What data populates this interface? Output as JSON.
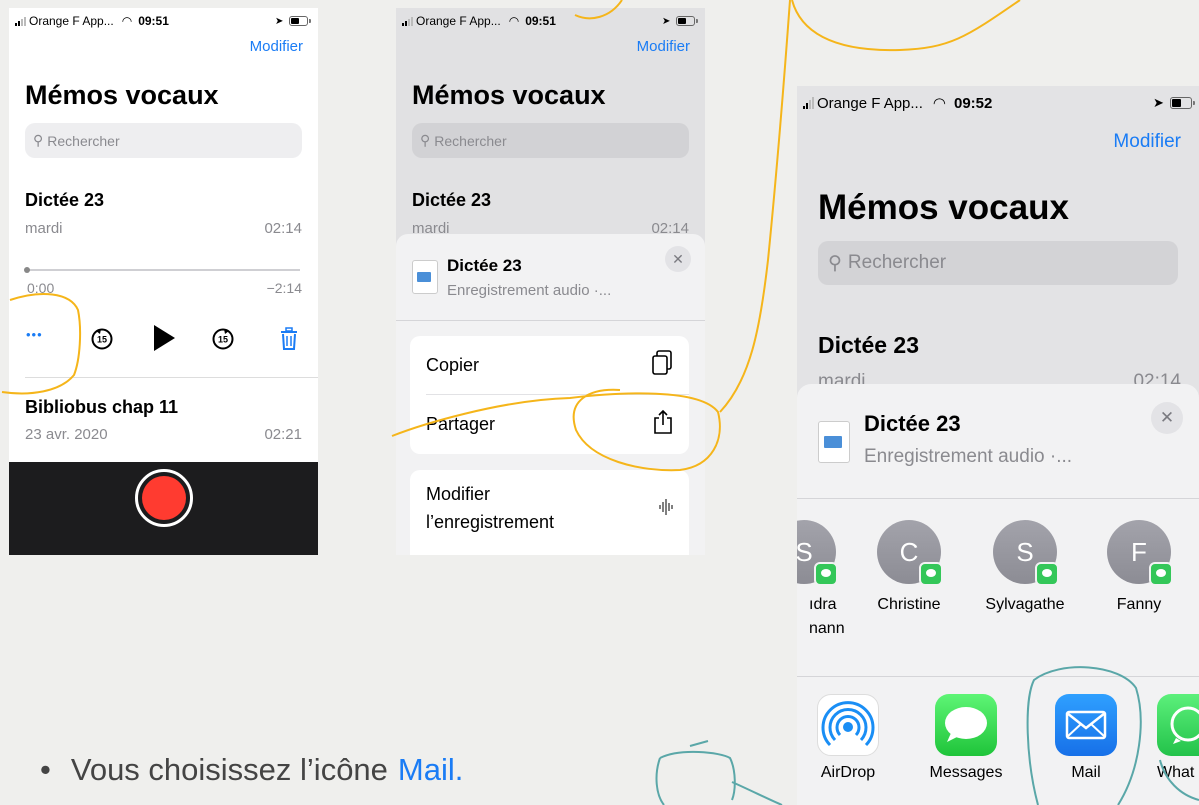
{
  "status": {
    "carrier": "Orange F App...",
    "time1": "09:51",
    "time2": "09:51",
    "time3": "09:52"
  },
  "header": {
    "edit_label": "Modifier",
    "title": "Mémos vocaux",
    "search_placeholder": "Rechercher"
  },
  "screen1": {
    "memo1": {
      "name": "Dictée 23",
      "date": "mardi",
      "duration": "02:14"
    },
    "player": {
      "elapsed": "0:00",
      "remaining": "−2:14",
      "progress": 0.0,
      "more": "•••",
      "skip_back": "15",
      "skip_fwd": "15"
    },
    "memo2": {
      "name": "Bibliobus chap 11",
      "date": "23 avr. 2020",
      "duration": "02:21"
    }
  },
  "screen2": {
    "memo_name": "Dictée 23",
    "memo_date": "mardi",
    "memo_duration": "02:14",
    "sheet": {
      "title": "Dictée 23",
      "subtitle": "Enregistrement audio ·...",
      "copy": "Copier",
      "share": "Partager",
      "edit_line1": "Modifier",
      "edit_line2": "l’enregistrement"
    }
  },
  "screen3": {
    "memo_name": "Dictée 23",
    "memo_date": "mardi",
    "memo_duration": "02:14",
    "sheet": {
      "title": "Dictée 23",
      "subtitle": "Enregistrement audio ·..."
    },
    "contacts": [
      {
        "initial": "S",
        "name_line1": "ıdra",
        "name_line2": "nann"
      },
      {
        "initial": "C",
        "name_line1": "Christine",
        "name_line2": ""
      },
      {
        "initial": "S",
        "name_line1": "Sylvagathe",
        "name_line2": ""
      },
      {
        "initial": "F",
        "name_line1": "Fanny",
        "name_line2": ""
      }
    ],
    "apps": [
      {
        "label": "AirDrop",
        "icon": "airdrop-icon"
      },
      {
        "label": "Messages",
        "icon": "messages-icon"
      },
      {
        "label": "Mail",
        "icon": "mail-icon"
      },
      {
        "label": "What",
        "icon": "whatsapp-icon"
      }
    ]
  },
  "caption": {
    "bullet": "•",
    "text": "Vous choisissez l’icône",
    "highlight": "Mail."
  },
  "colors": {
    "ios_blue": "#1a7cf5",
    "record_red": "#ff3b30",
    "annotation_yellow": "#f5b51a",
    "annotation_teal": "#5aa7a8"
  }
}
